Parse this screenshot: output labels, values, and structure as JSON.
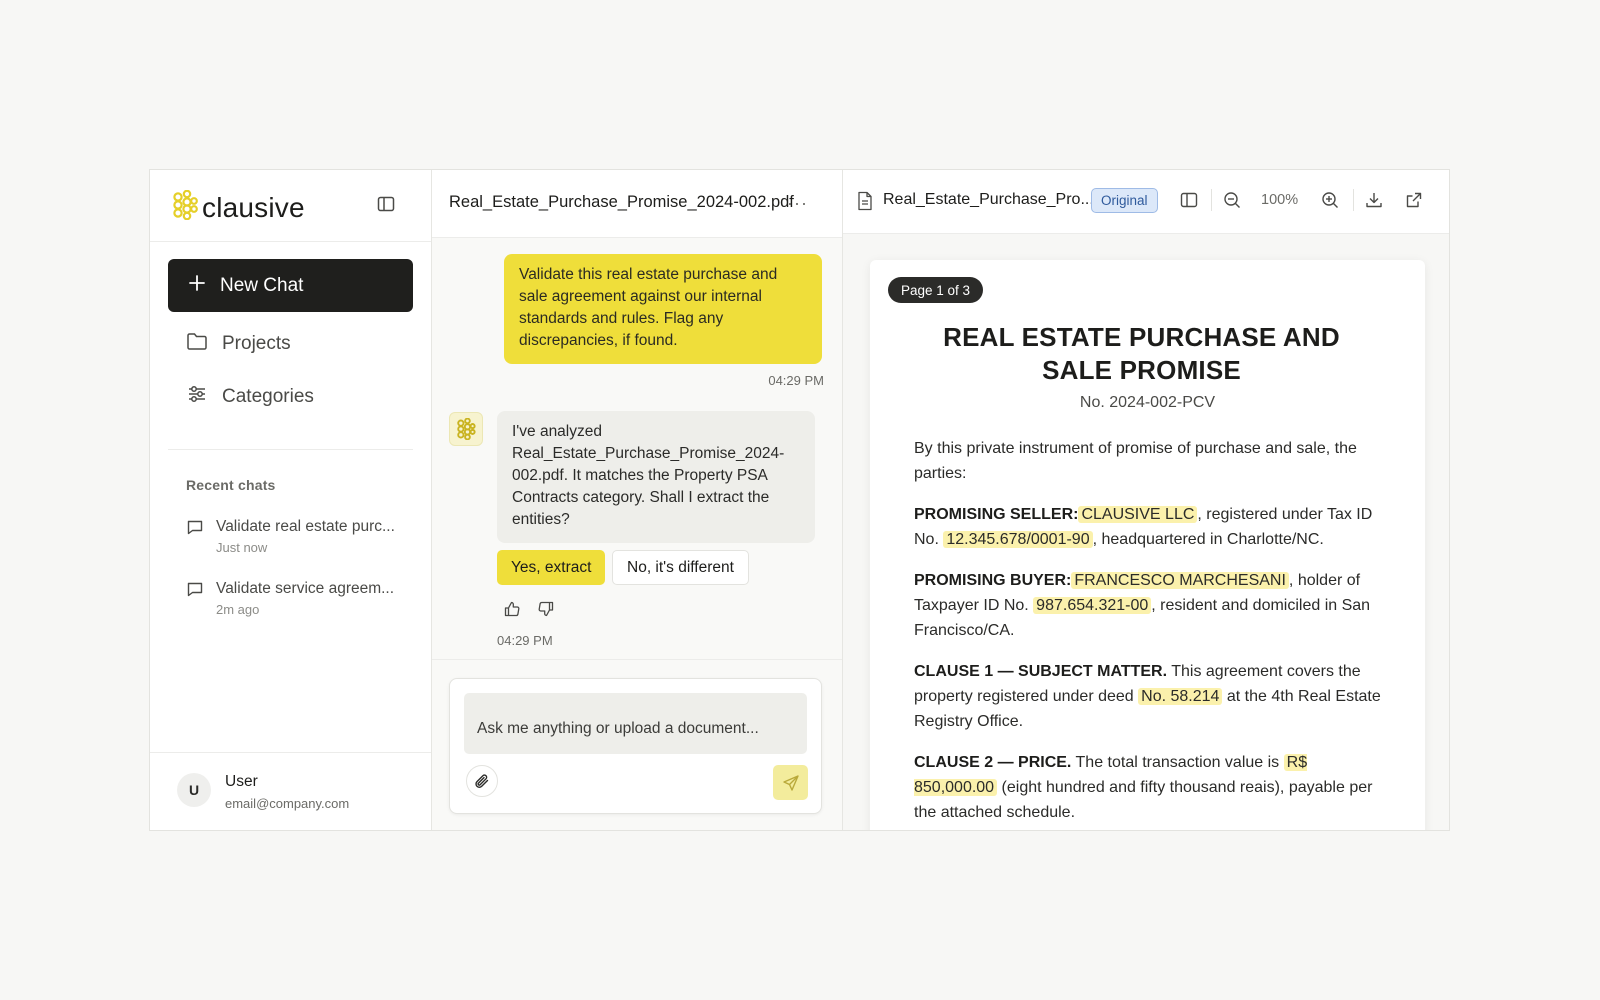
{
  "brand": {
    "name": "clausive"
  },
  "sidebar": {
    "new_chat": "New Chat",
    "nav": [
      {
        "label": "Projects",
        "icon": "folder-icon"
      },
      {
        "label": "Categories",
        "icon": "sliders-icon"
      }
    ],
    "recent_title": "Recent chats",
    "recent": [
      {
        "title": "Validate real estate purc...",
        "time": "Just now"
      },
      {
        "title": "Validate service agreem...",
        "time": "2m ago"
      }
    ],
    "user": {
      "initial": "U",
      "name": "User",
      "email": "email@company.com"
    }
  },
  "chat": {
    "title": "Real_Estate_Purchase_Promise_2024-002.pdf",
    "more": "···",
    "user_message": "Validate this real estate purchase and sale agreement against our internal standards and rules. Flag any discrepancies, if found.",
    "user_time": "04:29 PM",
    "bot_message": "I've analyzed Real_Estate_Purchase_Promise_2024-002.pdf. It matches the Property PSA Contracts category. Shall I extract the entities?",
    "yes_label": "Yes, extract",
    "no_label": "No, it's different",
    "bot_time": "04:29 PM",
    "composer_placeholder": "Ask me anything or upload a document..."
  },
  "viewer": {
    "file_name": "Real_Estate_Purchase_Pro...",
    "badge": "Original",
    "zoom": "100%",
    "page_label": "Page 1 of 3",
    "doc": {
      "title": "REAL ESTATE PURCHASE AND SALE PROMISE",
      "number": "No. 2024-002-PCV",
      "intro": "By this private instrument of promise of purchase and sale, the parties:",
      "seller_label": "PROMISING SELLER:",
      "seller_name": "CLAUSIVE LLC",
      "seller_text1": ", registered under Tax ID No.",
      "seller_taxid": "12.345.678/0001-90",
      "seller_text2": ", headquartered in Charlotte/NC.",
      "buyer_label": "PROMISING BUYER:",
      "buyer_name": "FRANCESCO MARCHESANI",
      "buyer_text1": ", holder of Taxpayer ID No.",
      "buyer_taxid": "987.654.321-00",
      "buyer_text2": ", resident and domiciled in San Francisco/CA.",
      "clause1_label": "CLAUSE 1 — SUBJECT MATTER.",
      "clause1_text1": "This agreement covers the property registered under deed",
      "clause1_deed": "No. 58.214",
      "clause1_text2": "at the 4th Real Estate Registry Office.",
      "clause2_label": "CLAUSE 2 — PRICE.",
      "clause2_text1": "The total transaction value is",
      "clause2_price": "R$ 850,000.00",
      "clause2_text2": "(eight hundred and fifty thousand reais), payable per the attached schedule."
    }
  },
  "colors": {
    "accent": "#efde3a",
    "dark_button": "#1f1f1d",
    "highlight": "#fbf1ac",
    "badge_blue": "#2f5a9c"
  }
}
